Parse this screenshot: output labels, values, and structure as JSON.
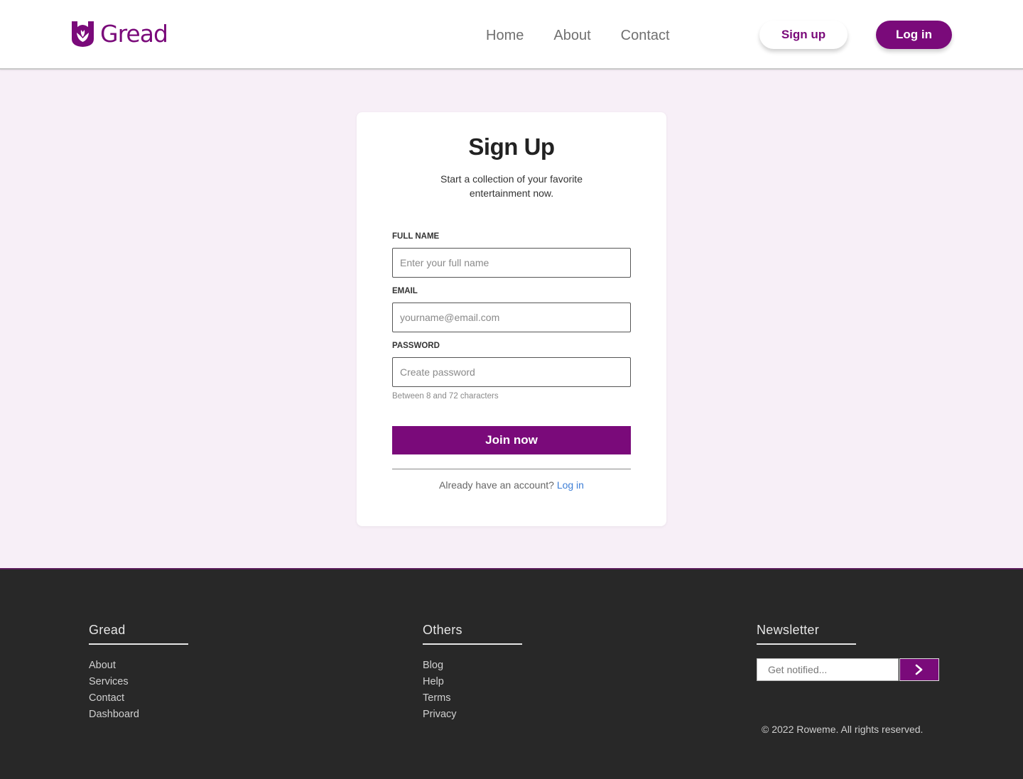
{
  "header": {
    "logo_text": "Gread",
    "nav": [
      "Home",
      "About",
      "Contact"
    ],
    "signup_label": "Sign up",
    "login_label": "Log in"
  },
  "signup": {
    "title": "Sign Up",
    "subtitle": "Start a collection of your favorite entertainment now.",
    "fields": [
      {
        "label": "FULL NAME",
        "placeholder": "Enter your full name",
        "value": ""
      },
      {
        "label": "EMAIL",
        "placeholder": "yourname@email.com",
        "value": ""
      },
      {
        "label": "PASSWORD",
        "placeholder": "Create password",
        "value": ""
      }
    ],
    "password_hint": "Between 8 and 72 characters",
    "join_label": "Join now",
    "already_text": "Already have an account?",
    "login_link": "Log in"
  },
  "footer": {
    "columns": [
      {
        "title": "Gread",
        "items": [
          "About",
          "Services",
          "Contact",
          "Dashboard"
        ]
      },
      {
        "title": "Others",
        "items": [
          "Blog",
          "Help",
          "Terms",
          "Privacy"
        ]
      }
    ],
    "newsletter": {
      "title": "Newsletter",
      "placeholder": "Get notified...",
      "button_icon": "chevron-right-icon"
    },
    "copyright": "© 2022 Roweme. All rights reserved."
  },
  "colors": {
    "brand": "#7a0a7a",
    "page_bg": "#f7eff7",
    "footer_bg": "#282828",
    "link": "#3d7ed6"
  }
}
